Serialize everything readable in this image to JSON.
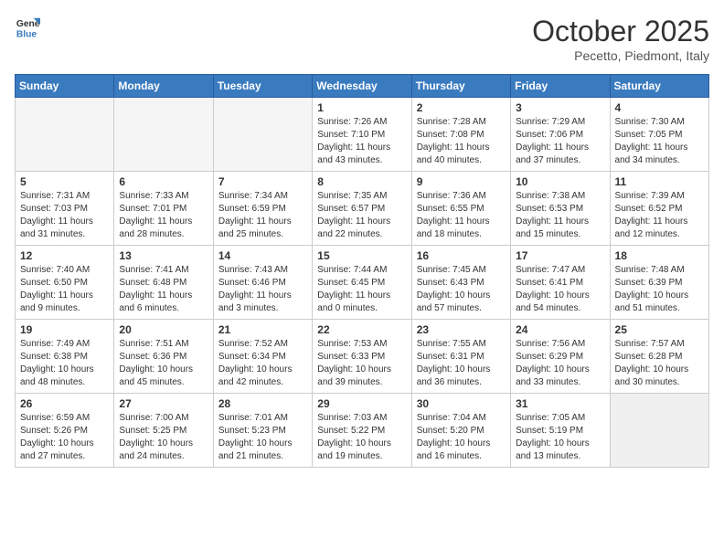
{
  "logo": {
    "general": "General",
    "blue": "Blue"
  },
  "title": "October 2025",
  "subtitle": "Pecetto, Piedmont, Italy",
  "days_of_week": [
    "Sunday",
    "Monday",
    "Tuesday",
    "Wednesday",
    "Thursday",
    "Friday",
    "Saturday"
  ],
  "weeks": [
    [
      {
        "num": "",
        "info": ""
      },
      {
        "num": "",
        "info": ""
      },
      {
        "num": "",
        "info": ""
      },
      {
        "num": "1",
        "info": "Sunrise: 7:26 AM\nSunset: 7:10 PM\nDaylight: 11 hours\nand 43 minutes."
      },
      {
        "num": "2",
        "info": "Sunrise: 7:28 AM\nSunset: 7:08 PM\nDaylight: 11 hours\nand 40 minutes."
      },
      {
        "num": "3",
        "info": "Sunrise: 7:29 AM\nSunset: 7:06 PM\nDaylight: 11 hours\nand 37 minutes."
      },
      {
        "num": "4",
        "info": "Sunrise: 7:30 AM\nSunset: 7:05 PM\nDaylight: 11 hours\nand 34 minutes."
      }
    ],
    [
      {
        "num": "5",
        "info": "Sunrise: 7:31 AM\nSunset: 7:03 PM\nDaylight: 11 hours\nand 31 minutes."
      },
      {
        "num": "6",
        "info": "Sunrise: 7:33 AM\nSunset: 7:01 PM\nDaylight: 11 hours\nand 28 minutes."
      },
      {
        "num": "7",
        "info": "Sunrise: 7:34 AM\nSunset: 6:59 PM\nDaylight: 11 hours\nand 25 minutes."
      },
      {
        "num": "8",
        "info": "Sunrise: 7:35 AM\nSunset: 6:57 PM\nDaylight: 11 hours\nand 22 minutes."
      },
      {
        "num": "9",
        "info": "Sunrise: 7:36 AM\nSunset: 6:55 PM\nDaylight: 11 hours\nand 18 minutes."
      },
      {
        "num": "10",
        "info": "Sunrise: 7:38 AM\nSunset: 6:53 PM\nDaylight: 11 hours\nand 15 minutes."
      },
      {
        "num": "11",
        "info": "Sunrise: 7:39 AM\nSunset: 6:52 PM\nDaylight: 11 hours\nand 12 minutes."
      }
    ],
    [
      {
        "num": "12",
        "info": "Sunrise: 7:40 AM\nSunset: 6:50 PM\nDaylight: 11 hours\nand 9 minutes."
      },
      {
        "num": "13",
        "info": "Sunrise: 7:41 AM\nSunset: 6:48 PM\nDaylight: 11 hours\nand 6 minutes."
      },
      {
        "num": "14",
        "info": "Sunrise: 7:43 AM\nSunset: 6:46 PM\nDaylight: 11 hours\nand 3 minutes."
      },
      {
        "num": "15",
        "info": "Sunrise: 7:44 AM\nSunset: 6:45 PM\nDaylight: 11 hours\nand 0 minutes."
      },
      {
        "num": "16",
        "info": "Sunrise: 7:45 AM\nSunset: 6:43 PM\nDaylight: 10 hours\nand 57 minutes."
      },
      {
        "num": "17",
        "info": "Sunrise: 7:47 AM\nSunset: 6:41 PM\nDaylight: 10 hours\nand 54 minutes."
      },
      {
        "num": "18",
        "info": "Sunrise: 7:48 AM\nSunset: 6:39 PM\nDaylight: 10 hours\nand 51 minutes."
      }
    ],
    [
      {
        "num": "19",
        "info": "Sunrise: 7:49 AM\nSunset: 6:38 PM\nDaylight: 10 hours\nand 48 minutes."
      },
      {
        "num": "20",
        "info": "Sunrise: 7:51 AM\nSunset: 6:36 PM\nDaylight: 10 hours\nand 45 minutes."
      },
      {
        "num": "21",
        "info": "Sunrise: 7:52 AM\nSunset: 6:34 PM\nDaylight: 10 hours\nand 42 minutes."
      },
      {
        "num": "22",
        "info": "Sunrise: 7:53 AM\nSunset: 6:33 PM\nDaylight: 10 hours\nand 39 minutes."
      },
      {
        "num": "23",
        "info": "Sunrise: 7:55 AM\nSunset: 6:31 PM\nDaylight: 10 hours\nand 36 minutes."
      },
      {
        "num": "24",
        "info": "Sunrise: 7:56 AM\nSunset: 6:29 PM\nDaylight: 10 hours\nand 33 minutes."
      },
      {
        "num": "25",
        "info": "Sunrise: 7:57 AM\nSunset: 6:28 PM\nDaylight: 10 hours\nand 30 minutes."
      }
    ],
    [
      {
        "num": "26",
        "info": "Sunrise: 6:59 AM\nSunset: 5:26 PM\nDaylight: 10 hours\nand 27 minutes."
      },
      {
        "num": "27",
        "info": "Sunrise: 7:00 AM\nSunset: 5:25 PM\nDaylight: 10 hours\nand 24 minutes."
      },
      {
        "num": "28",
        "info": "Sunrise: 7:01 AM\nSunset: 5:23 PM\nDaylight: 10 hours\nand 21 minutes."
      },
      {
        "num": "29",
        "info": "Sunrise: 7:03 AM\nSunset: 5:22 PM\nDaylight: 10 hours\nand 19 minutes."
      },
      {
        "num": "30",
        "info": "Sunrise: 7:04 AM\nSunset: 5:20 PM\nDaylight: 10 hours\nand 16 minutes."
      },
      {
        "num": "31",
        "info": "Sunrise: 7:05 AM\nSunset: 5:19 PM\nDaylight: 10 hours\nand 13 minutes."
      },
      {
        "num": "",
        "info": ""
      }
    ]
  ]
}
